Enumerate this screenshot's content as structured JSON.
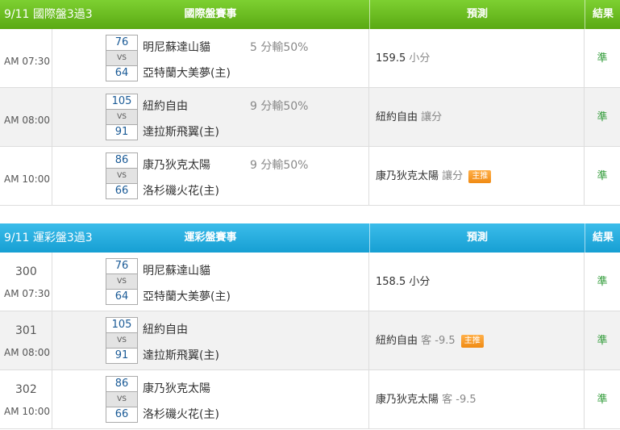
{
  "international": {
    "title": "9/11 國際盤3過3",
    "events_header": "國際盤賽事",
    "prediction_header": "預測",
    "result_header": "結果",
    "rows": [
      {
        "time": "AM 07:30",
        "away": "明尼蘇達山貓",
        "home": "亞特蘭大美夢(主)",
        "away_score": "76",
        "home_score": "64",
        "handicap": "5 分輸50%",
        "prediction": "159.5",
        "prediction_type": "小分",
        "badge": "",
        "result": "準"
      },
      {
        "time": "AM 08:00",
        "away": "紐約自由",
        "home": "達拉斯飛翼(主)",
        "away_score": "105",
        "home_score": "91",
        "handicap": "9 分輸50%",
        "prediction": "紐約自由",
        "prediction_type": "讓分",
        "badge": "",
        "result": "準"
      },
      {
        "time": "AM 10:00",
        "away": "康乃狄克太陽",
        "home": "洛杉磯火花(主)",
        "away_score": "86",
        "home_score": "66",
        "handicap": "9 分輸50%",
        "prediction": "康乃狄克太陽",
        "prediction_type": "讓分",
        "badge": "主推",
        "result": "準"
      }
    ]
  },
  "sports_lottery": {
    "title": "9/11 運彩盤3過3",
    "events_header": "運彩盤賽事",
    "prediction_header": "預測",
    "result_header": "結果",
    "rows": [
      {
        "number": "300",
        "time": "AM 07:30",
        "away": "明尼蘇達山貓",
        "home": "亞特蘭大美夢(主)",
        "away_score": "76",
        "home_score": "64",
        "prediction": "158.5",
        "prediction_type": "小分",
        "badge": "",
        "result": "準"
      },
      {
        "number": "301",
        "time": "AM 08:00",
        "away": "紐約自由",
        "home": "達拉斯飛翼(主)",
        "away_score": "105",
        "home_score": "91",
        "prediction": "紐約自由",
        "prediction_type": "客 -9.5",
        "badge": "主推",
        "result": "準"
      },
      {
        "number": "302",
        "time": "AM 10:00",
        "away": "康乃狄克太陽",
        "home": "洛杉磯火花(主)",
        "away_score": "86",
        "home_score": "66",
        "prediction": "康乃狄克太陽",
        "prediction_type": "客 -9.5",
        "badge": "",
        "result": "準"
      }
    ]
  },
  "vs_label": "VS",
  "colors": {
    "green_header": "#6cc023",
    "blue_header": "#1faee0",
    "result_green": "#2e9a36",
    "badge_orange": "#f59a20",
    "score_blue": "#1a5a96"
  }
}
